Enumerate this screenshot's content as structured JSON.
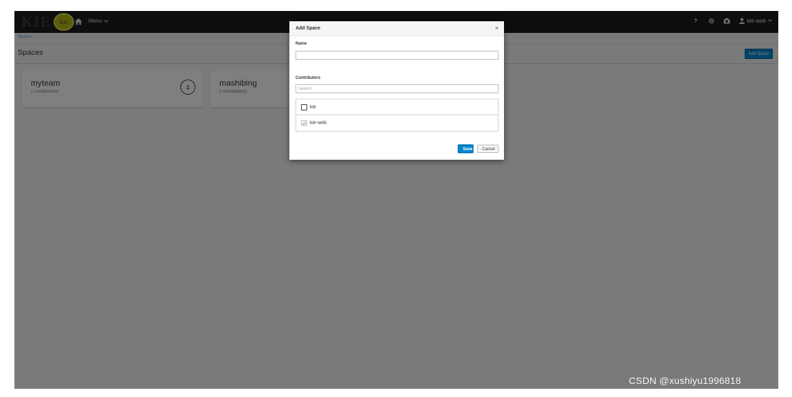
{
  "navbar": {
    "logo_text": "KIE",
    "logo_badge": "IDE",
    "home_icon": "home-icon",
    "menu_label": "Menu",
    "help_label": "?",
    "user_label": "kie-web"
  },
  "breadcrumb": {
    "item": "Spaces"
  },
  "page": {
    "title": "Spaces",
    "add_space_button": "Add Space"
  },
  "spaces": [
    {
      "name": "myteam",
      "contributors": "1 contributor(s)",
      "badge": "1"
    },
    {
      "name": "mashibing",
      "contributors": "1 contributor(s)"
    }
  ],
  "modal": {
    "title": "Add Space",
    "close": "×",
    "name_label": "Name",
    "name_value": "",
    "contributors_label": "Contributors",
    "search_placeholder": "Search",
    "contributors": [
      {
        "label": "kie",
        "checked": false,
        "disabled": false
      },
      {
        "label": "kie-web",
        "checked": true,
        "disabled": true
      }
    ],
    "save_label": "Save",
    "cancel_label": "Cancel"
  },
  "watermark": "CSDN @xushiyu1996818",
  "colors": {
    "navbar_bg": "#1c1c1c",
    "primary": "#0088ce",
    "logo_badge": "#b6ba1a",
    "link": "#39a5dc"
  }
}
